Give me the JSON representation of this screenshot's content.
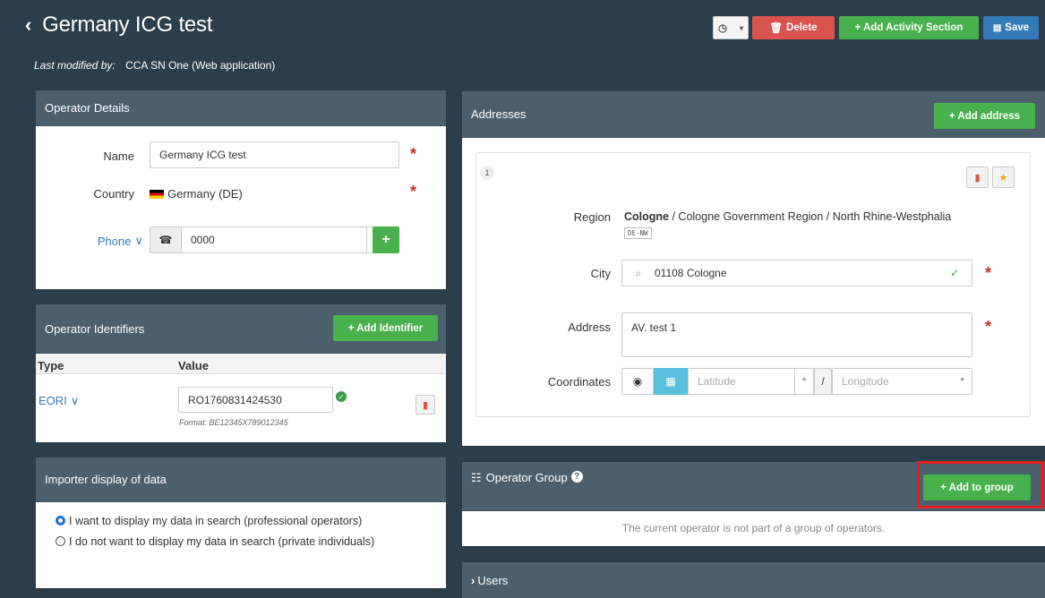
{
  "header": {
    "back_icon": "chevron-left-icon",
    "title": "Germany ICG test",
    "modified_label": "Last modified by:",
    "modified_value": "CCA SN One (Web application)"
  },
  "toolbar": {
    "history_icon": "clock-icon",
    "delete_label": "Delete",
    "add_activity_label": "+ Add Activity Section",
    "save_label": "Save"
  },
  "operator_details": {
    "title": "Operator Details",
    "name_label": "Name",
    "name_value": "Germany ICG test",
    "country_label": "Country",
    "country_value": "Germany (DE)",
    "phone_label": "Phone",
    "phone_value": "0000"
  },
  "identifiers": {
    "title": "Operator Identifiers",
    "add_label": "+ Add Identifier",
    "col_type": "Type",
    "col_value": "Value",
    "row_type": "EORI",
    "row_value": "RO1760831424530",
    "row_format": "Format: BE12345X789012345"
  },
  "importer": {
    "title": "Importer display of data",
    "option1": "I want to display my data in search (professional operators)",
    "option2": "I do not want to display my data in search (private individuals)",
    "selected": 1
  },
  "addresses": {
    "title": "Addresses",
    "add_label": "+ Add address",
    "index": "1",
    "region_label": "Region",
    "region_bold": "Cologne",
    "region_rest": " / Cologne Government Region / North Rhine-Westphalia",
    "region_code": "DE-NW",
    "city_label": "City",
    "city_value": "01108 Cologne",
    "address_label": "Address",
    "address_value": "AV. test 1",
    "coords_label": "Coordinates",
    "lat_placeholder": "Latitude",
    "lon_placeholder": "Longitude",
    "deg": "°",
    "slash": "/"
  },
  "group": {
    "title": "Operator Group",
    "add_label": "+ Add to group",
    "message": "The current operator is not part of a group of operators."
  },
  "users": {
    "title": "Users"
  },
  "colors": {
    "background": "#2b3e4c",
    "panel_header": "#4b5f6d",
    "green": "#48b04c",
    "red": "#d9534f",
    "blue": "#337ab7",
    "highlight": "#e0201f"
  }
}
